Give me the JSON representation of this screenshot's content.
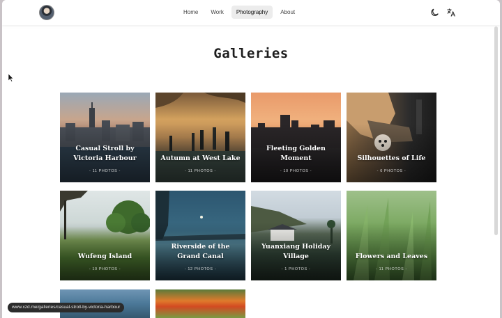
{
  "nav": {
    "items": [
      {
        "label": "Home",
        "active": false
      },
      {
        "label": "Work",
        "active": false
      },
      {
        "label": "Photography",
        "active": true
      },
      {
        "label": "About",
        "active": false
      }
    ]
  },
  "header_icons": [
    "moon-icon",
    "translate-icon"
  ],
  "page": {
    "title": "Galleries"
  },
  "galleries": [
    {
      "title": "Casual Stroll by Victoria Harbour",
      "count": "- 11 PHOTOS -"
    },
    {
      "title": "Autumn at West Lake",
      "count": "- 11 PHOTOS -"
    },
    {
      "title": "Fleeting Golden Moment",
      "count": "- 10 PHOTOS -"
    },
    {
      "title": "Silhouettes of Life",
      "count": "- 6 PHOTOS -"
    },
    {
      "title": "Wufeng Island",
      "count": "- 10 PHOTOS -"
    },
    {
      "title": "Riverside of the Grand Canal",
      "count": "- 12 PHOTOS -"
    },
    {
      "title": "Yuanxiang Holiday Village",
      "count": "- 1 PHOTOS -"
    },
    {
      "title": "Flowers and Leaves",
      "count": "- 11 PHOTOS -"
    }
  ],
  "status_bar": {
    "url": "www.xzd.me/galleries/casual-stroll-by-victoria-harbour"
  }
}
